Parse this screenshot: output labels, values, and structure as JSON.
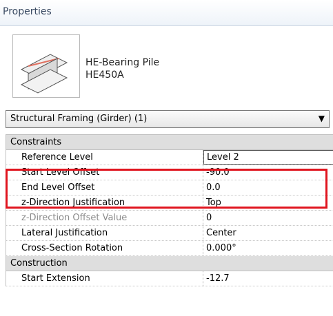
{
  "panel": {
    "title": "Properties"
  },
  "type_selector": {
    "family": "HE-Bearing Pile",
    "type": "HE450A",
    "icon": "steel-beam-icon"
  },
  "category_dropdown": {
    "value": "Structural Framing (Girder) (1)",
    "icon": "chevron-down-icon"
  },
  "sections": [
    {
      "title": "Constraints",
      "rows": [
        {
          "label": "Reference Level",
          "value": "Level 2"
        },
        {
          "label": "Start Level Offset",
          "value": "-90.0"
        },
        {
          "label": "End Level Offset",
          "value": "0.0"
        },
        {
          "label": "z-Direction Justification",
          "value": "Top"
        },
        {
          "label": "z-Direction Offset Value",
          "value": "0"
        },
        {
          "label": "Lateral Justification",
          "value": "Center"
        },
        {
          "label": "Cross-Section Rotation",
          "value": "0.000°"
        }
      ]
    },
    {
      "title": "Construction",
      "rows": [
        {
          "label": "Start Extension",
          "value": "-12.7"
        }
      ]
    }
  ],
  "annotation": {
    "highlight_color": "#e0141e"
  }
}
